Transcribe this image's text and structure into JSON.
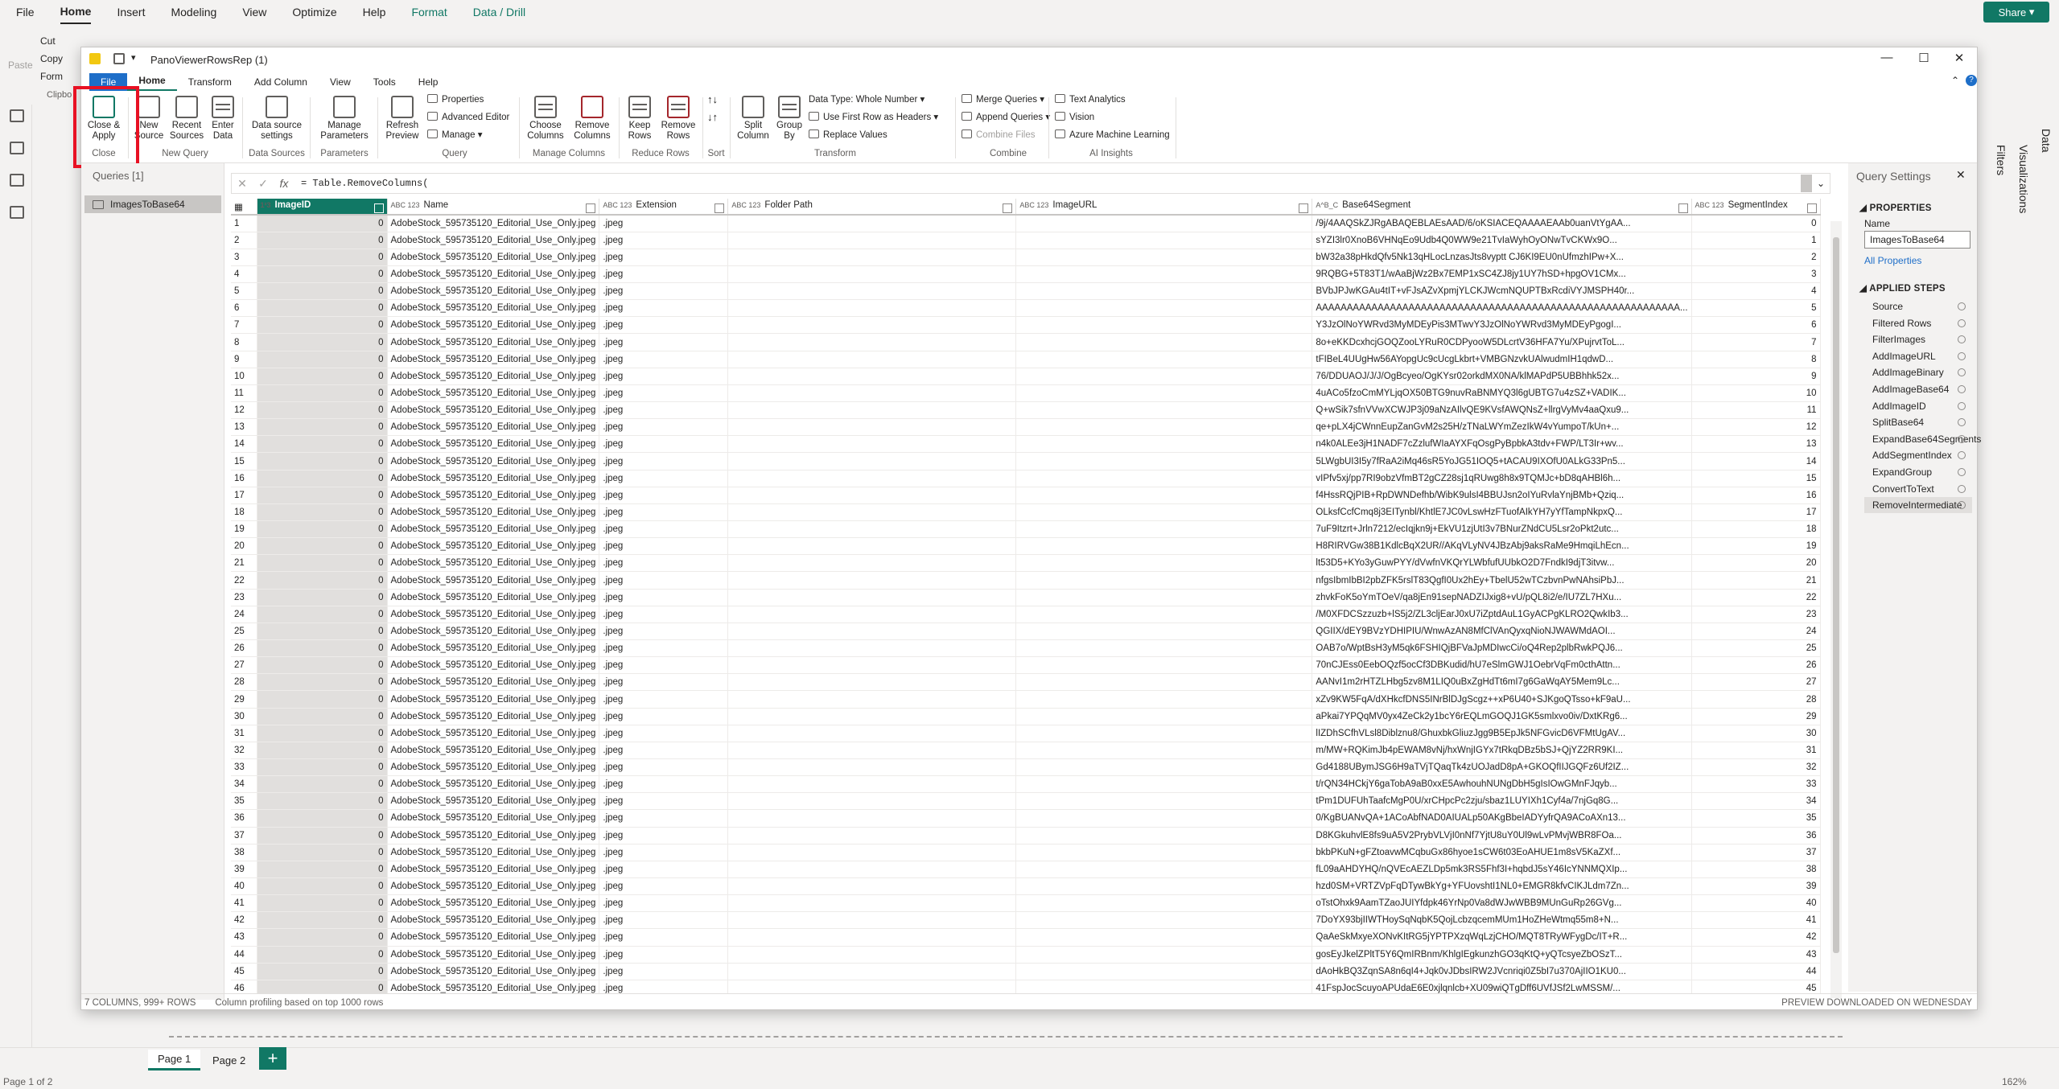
{
  "pbi": {
    "tabs": [
      "File",
      "Home",
      "Insert",
      "Modeling",
      "View",
      "Optimize",
      "Help",
      "Format",
      "Data / Drill"
    ],
    "share_label": "Share",
    "clipboard": [
      "Cut",
      "Copy",
      "Form"
    ],
    "clipboard_group": "Clipbo",
    "paste_label": "Paste",
    "panes": [
      "Filters",
      "Visualizations",
      "Data"
    ],
    "pages": [
      "Page 1",
      "Page 2"
    ],
    "add_page": "+",
    "status_left": "Page 1 of 2",
    "zoom": "162%"
  },
  "pq": {
    "title": "PanoViewerRowsRep (1)",
    "tabs": [
      "File",
      "Home",
      "Transform",
      "Add Column",
      "View",
      "Tools",
      "Help"
    ],
    "ribbon": {
      "close_apply": "Close & Apply",
      "new_source": "New Source",
      "recent_sources": "Recent Sources",
      "enter_data": "Enter Data",
      "data_source_settings": "Data source settings",
      "manage_parameters": "Manage Parameters",
      "refresh_preview": "Refresh Preview",
      "properties": "Properties",
      "advanced_editor": "Advanced Editor",
      "manage": "Manage",
      "choose_columns": "Choose Columns",
      "remove_columns": "Remove Columns",
      "keep_rows": "Keep Rows",
      "remove_rows": "Remove Rows",
      "split_column": "Split Column",
      "group_by": "Group By",
      "data_type": "Data Type: Whole Number",
      "first_row_headers": "Use First Row as Headers",
      "replace_values": "Replace Values",
      "merge_queries": "Merge Queries",
      "append_queries": "Append Queries",
      "combine_files": "Combine Files",
      "text_analytics": "Text Analytics",
      "vision": "Vision",
      "azure_ml": "Azure Machine Learning",
      "groups": [
        "Close",
        "New Query",
        "Data Sources",
        "Parameters",
        "Query",
        "Manage Columns",
        "Reduce Rows",
        "Sort",
        "Transform",
        "Combine",
        "AI Insights"
      ]
    },
    "queries_header": "Queries [1]",
    "query_name": "ImagesToBase64",
    "formula": "= Table.RemoveColumns(",
    "columns": [
      {
        "type": "1²3",
        "name": "ImageID"
      },
      {
        "type": "ABC 123",
        "name": "Name"
      },
      {
        "type": "ABC 123",
        "name": "Extension"
      },
      {
        "type": "ABC 123",
        "name": "Folder Path"
      },
      {
        "type": "ABC 123",
        "name": "ImageURL"
      },
      {
        "type": "A^B_C",
        "name": "Base64Segment"
      },
      {
        "type": "ABC 123",
        "name": "SegmentIndex"
      }
    ],
    "row_name": "AdobeStock_595735120_Editorial_Use_Only.jpeg",
    "row_ext": ".jpeg",
    "segments": [
      "/9j/4AAQSkZJRgABAQEBLAEsAAD/6/oKSIACEQAAAAEAAb0uanVtYgAA...",
      "sYZI3lr0XnoB6VHNqEo9Udb4Q0WW9e21TvIaWyhOyONwTvCKWx9O...",
      "bW32a38pHkdQfv5Nk13qHLocLnzasJts8vyptt CJ6KI9EU0nUfmzhIPw+X...",
      "9RQBG+5T83T1/wAaBjWz2Bx7EMP1xSC4ZJ8jy1UY7hSD+hpgOV1CMx...",
      "BVbJPJwKGAu4tIT+vFJsAZvXpmjYLCKJWcmNQUPTBxRcdiVYJMSPH40r...",
      "AAAAAAAAAAAAAAAAAAAAAAAAAAAAAAAAAAAAAAAAAAAAAAAAAAAAAAAAAAA...",
      "Y3JzOlNoYWRvd3MyMDEyPis3MTwvY3JzOlNoYWRvd3MyMDEyPgogI...",
      "8o+eKKDcxhcjGOQZooLYRuR0CDPyooW5DLcrtV36HFA7Yu/XPujrvtToL...",
      "tFIBeL4UUgHw56AYopgUc9cUcgLkbrt+VMBGNzvkUAlwudmIH1qdwD...",
      "76/DDUAOJ/J/J/OgBcyeo/OgKYsr02orkdMX0NA/klMAPdP5UBBhhk52x...",
      "4uACo5fzoCmMYLjqOX50BTG9nuvRaBNMYQ3l6gUBTG7u4zSZ+VADIK...",
      "Q+wSik7sfnVVwXCWJP3j09aNzAIlvQE9KVsfAWQNsZ+llrgVyMv4aaQxu9...",
      "qe+pLX4jCWnnEupZanGvM2s25H/zTNaLWYmZezIkW4vYumpoT/kUn+...",
      "n4k0ALEe3jH1NADF7cZzlufWIaAYXFqOsgPyBpbkA3tdv+FWP/LT3Ir+wv...",
      "5LWgbUI3I5y7fRaA2iMq46sR5YoJG51IOQ5+tACAU9IXOfU0ALkG33Pn5...",
      "vIPfv5xj/pp7RI9obzVfmBT2gCZ28sj1qRUwg8h8x9TQMJc+bD8qAHBl6h...",
      "f4HssRQjPIB+RpDWNDefhb/WibK9ulsI4BBUJsn2oIYuRvlaYnjBMb+Qziq...",
      "OLksfCcfCmq8j3EITynbl/KhtlE7JC0vLswHzFTuofAIkYH7yYfTampNkpxQ...",
      "7uF9Itzrt+Jrln7212/ecIqjkn9j+EkVU1zjUtI3v7BNurZNdCU5Lsr2oPkt2utc...",
      "H8RIRVGw38B1KdlcBqX2UR//AKqVLyNV4JBzAbj9aksRaMe9HmqiLhEcn...",
      "lt53D5+KYo3yGuwPYY/dVwfnVKQrYLWbfufUUbkO2D7FndkI9djT3itvw...",
      "nfgsIbmIbBI2pbZFK5rslT83QgfI0Ux2hEy+TbelU52wTCzbvnPwNAhsiPbJ...",
      "zhvkFoK5oYmTOeV/qa8jEn91sepNADZIJxig8+vU/pQL8i2/e/IU7ZL7HXu...",
      "/M0XFDCSzzuzb+lS5j2/ZL3cljEarJ0xU7iZptdAuL1GyACPgKLRO2QwkIb3...",
      "QGIIX/dEY9BVzYDHIPIU/WnwAzAN8MfClVAnQyxqNioNJWAWMdAOI...",
      "OAB7o/WptBsH3yM5qk6FSHIQjBFVaJpMDIwcCi/oQ4Rep2plbRwkPQJ6...",
      "70nCJEss0EebOQzf5ocCf3DBKudid/hU7eSlmGWJ1OebrVqFm0cthAttn...",
      "AANvI1m2rHTZLHbg5zv8M1LIQ0uBxZgHdTt6mI7g6GaWqAY5Mem9Lc...",
      "xZv9KW5FqA/dXHkcfDNS5INrBlDJgScgz++xP6U40+SJKgoQTsso+kF9aU...",
      "aPkai7YPQqMV0yx4ZeCk2y1bcY6rEQLmGOQJ1GK5smlxvo0iv/DxtKRg6...",
      "lIZDhSCfhVLsl8Diblznu8/GhuxbkGliuzJgg9B5EpJk5NFGvicD6VFMtUgAV...",
      "m/MW+RQKimJb4pEWAM8vNj/hxWnjIGYx7tRkqDBz5bSJ+QjYZ2RR9KI...",
      "Gd4188UBymJSG6H9aTVjTQaqTk4zUOJadD8pA+GKOQfIIJGQFz6Uf2IZ...",
      "t/rQN34HCkjY6gaTobA9aB0xxE5AwhouhNUNgDbH5gIsIOwGMnFJqyb...",
      "tPm1DUFUhTaafcMgP0U/xrCHpcPc2zju/sbaz1LUYIXh1Cyf4a/7njGq8G...",
      "0/KgBUANvQA+1ACoAbfNAD0AIUALp50AKgBbeIADYyfrQA9ACoAXn13...",
      "D8KGkuhvlE8fs9uA5V2PrybVLVjI0nNf7YjtU8uY0Ul9wLvPMvjWBR8FOa...",
      "bkbPKuN+gFZtoavwMCqbuGx86hyoe1sCW6t03EoAHUE1m8sV5KaZXf...",
      "fL09aAHDYHQ/nQVEcAEZLDp5mk3RS5Fhf3I+hqbdJ5sY46IcYNNMQXIp...",
      "hzd0SM+VRTZVpFqDTywBkYg+YFUovshtI1NL0+EMGR8kfvCIKJLdm7Zn...",
      "oTstOhxk9AamTZaoJUIYfdpk46YrNp0Va8dWJwWBB9MUnGuRp26GVg...",
      "7DoYX93bjIIWTHoySqNqbK5QojLcbzqcemMUm1HoZHeWtmq55m8+N...",
      "QaAeSkMxyeXONvKItRG5jYPTPXzqWqLzjCHO/MQT8TRyWFygDc/IT+R...",
      "gosEyJkelZPltT5Y6QmIRBnm/KhlgIEgkunzhGO3qKtQ+yQTcsyeZbOSzT...",
      "dAoHkBQ3ZqnSA8n6qI4+Jqk0vJDbsIRW2JVcnriqi0Z5bI7u370AjIIO1KU0...",
      "41FspJocScuyoAPUdaE6E0xjlqnlcb+XU09wiQTgDff6UVfJSf2LwMSSM/..."
    ],
    "status_left": "7 COLUMNS, 999+ ROWS",
    "status_profiling": "Column profiling based on top 1000 rows",
    "status_right": "PREVIEW DOWNLOADED ON WEDNESDAY",
    "settings": {
      "title": "Query Settings",
      "properties": "PROPERTIES",
      "name_label": "Name",
      "name_value": "ImagesToBase64",
      "all_properties": "All Properties",
      "applied_steps": "APPLIED STEPS",
      "steps": [
        "Source",
        "Filtered Rows",
        "FilterImages",
        "AddImageURL",
        "AddImageBinary",
        "AddImageBase64",
        "AddImageID",
        "SplitBase64",
        "ExpandBase64Segments",
        "AddSegmentIndex",
        "ExpandGroup",
        "ConvertToText",
        "RemoveIntermediate"
      ]
    }
  }
}
